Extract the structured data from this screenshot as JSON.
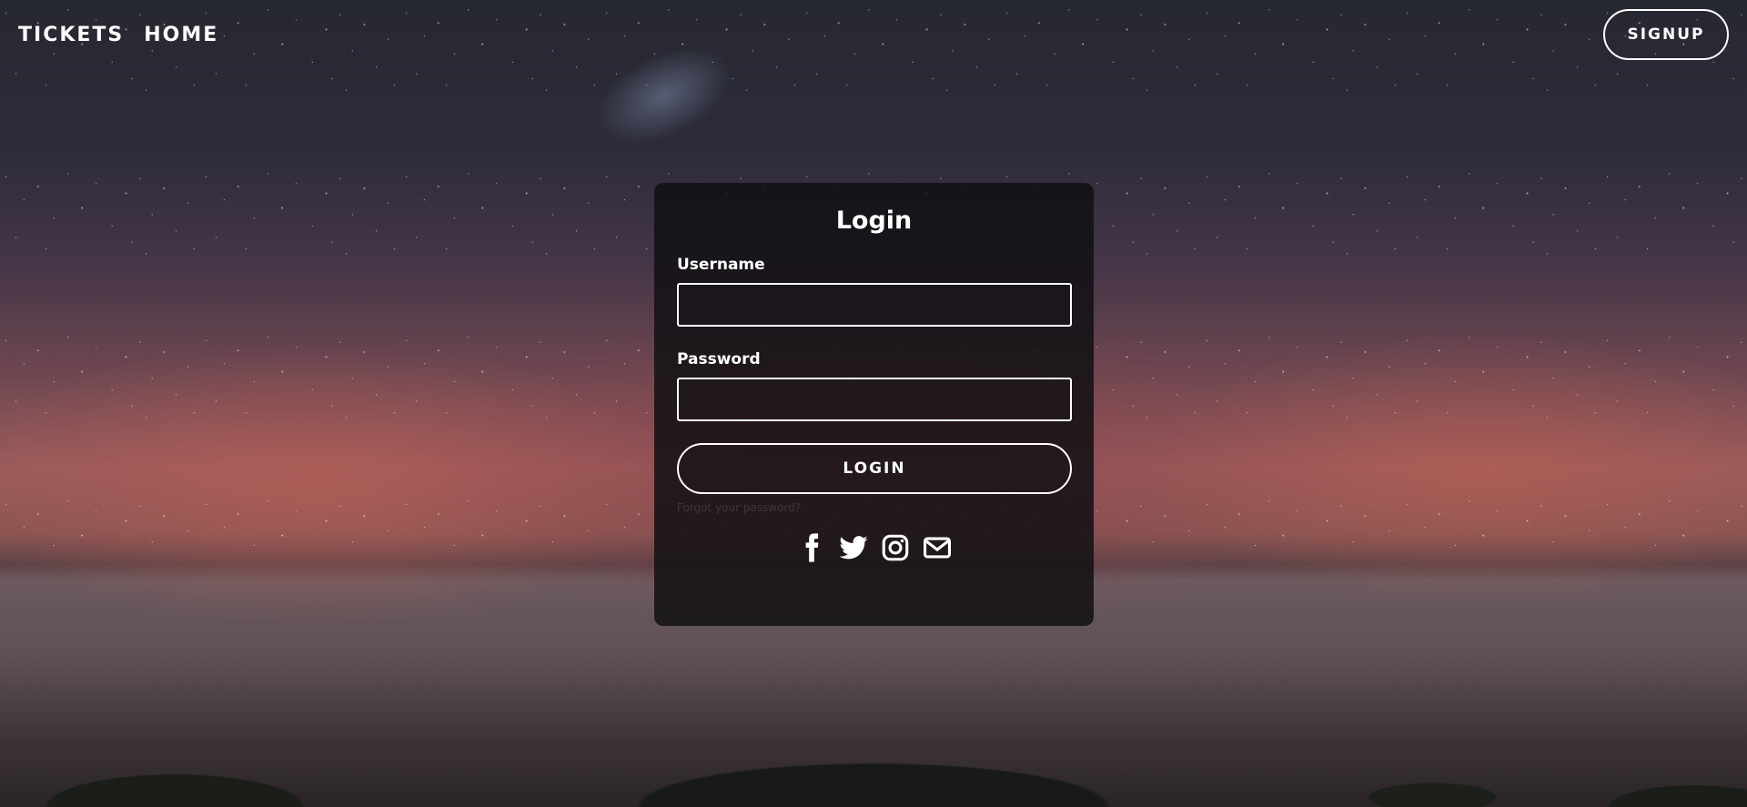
{
  "nav": {
    "tickets_label": "TICKETS",
    "home_label": "HOME",
    "signup_label": "SIGNUP"
  },
  "login_card": {
    "title": "Login",
    "username_label": "Username",
    "username_value": "",
    "password_label": "Password",
    "password_value": "",
    "submit_label": "LOGIN",
    "forgot_link": "Forgot your password?"
  },
  "social_icons": [
    "facebook-icon",
    "twitter-icon",
    "instagram-icon",
    "envelope-icon"
  ],
  "colors": {
    "text": "#ffffff",
    "card_background": "#121014",
    "border": "#ffffff"
  }
}
